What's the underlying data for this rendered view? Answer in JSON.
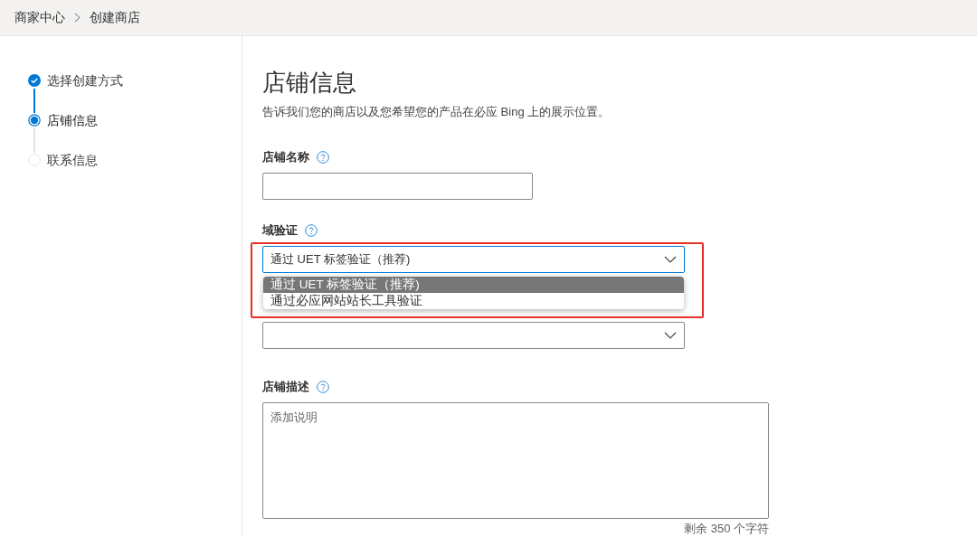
{
  "breadcrumb": [
    {
      "label": "商家中心"
    },
    {
      "label": "创建商店"
    }
  ],
  "steps": [
    {
      "label": "选择创建方式",
      "completed": true,
      "selected": false
    },
    {
      "label": "店铺信息",
      "completed": false,
      "selected": true
    },
    {
      "label": "联系信息",
      "completed": false,
      "selected": false
    }
  ],
  "title": "店铺信息",
  "subtitle": "告诉我们您的商店以及您希望您的产品在必应 Bing 上的展示位置。",
  "store_name": {
    "label": "店铺名称"
  },
  "domain_verification": {
    "label": "域验证",
    "value": "通过 UET 标签验证（推荐)",
    "expanded": true,
    "highlighted": true,
    "options": [
      {
        "label": "通过 UET 标签验证（推荐)",
        "selected": true
      },
      {
        "label": "通过必应网站站长工具验证",
        "selected": false
      }
    ]
  },
  "description": {
    "label": "店铺描述",
    "placeholder": "添加说明",
    "counter": "剩余 350 个字符"
  }
}
